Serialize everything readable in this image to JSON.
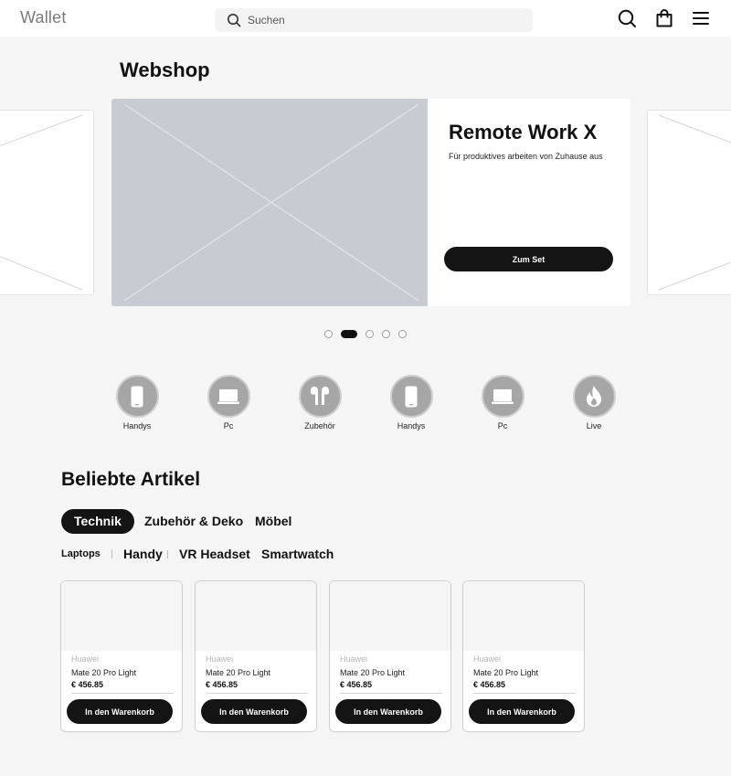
{
  "header": {
    "logo": "Wallet",
    "search_placeholder": "Suchen",
    "icons": [
      "search-icon",
      "shopping-bag-icon",
      "menu-icon"
    ]
  },
  "page_title": "Webshop",
  "hero": {
    "title": "Remote Work X",
    "subtitle": "Für produktives arbeiten von Zuhause aus",
    "button_label": "Zum Set",
    "slide_count": 5,
    "active_slide": 2
  },
  "categories": [
    {
      "label": "Handys",
      "icon": "phone-icon"
    },
    {
      "label": "Pc",
      "icon": "laptop-icon"
    },
    {
      "label": "Zubehör",
      "icon": "earbuds-icon"
    },
    {
      "label": "Handys",
      "icon": "phone-icon"
    },
    {
      "label": "Pc",
      "icon": "laptop-icon"
    },
    {
      "label": "Live",
      "icon": "flame-icon"
    }
  ],
  "popular": {
    "title": "Beliebte Artikel",
    "tabs": [
      {
        "label": "Technik",
        "active": true
      },
      {
        "label": "Zubehör & Deko",
        "active": false
      },
      {
        "label": "Möbel",
        "active": false
      }
    ],
    "subtabs": [
      {
        "label": "Laptops",
        "active": true
      },
      {
        "label": "Handy",
        "active": false
      },
      {
        "label": "VR Headset",
        "active": false
      },
      {
        "label": "Smartwatch",
        "active": false
      }
    ],
    "products": [
      {
        "brand": "Huawei",
        "name": "Mate 20 Pro Light",
        "price": "€ 456.85",
        "button": "In den Warenkorb"
      },
      {
        "brand": "Huawei",
        "name": "Mate 20 Pro Light",
        "price": "€ 456.85",
        "button": "In den Warenkorb"
      },
      {
        "brand": "Huawei",
        "name": "Mate 20 Pro Light",
        "price": "€ 456.85",
        "button": "In den Warenkorb"
      },
      {
        "brand": "Huawei",
        "name": "Mate 20 Pro Light",
        "price": "€ 456.85",
        "button": "In den Warenkorb"
      }
    ]
  },
  "colors": {
    "accent": "#141414",
    "background": "#f5f5f5",
    "placeholder_image": "#c9cbd3",
    "category_circle": "#a6a6a6"
  }
}
